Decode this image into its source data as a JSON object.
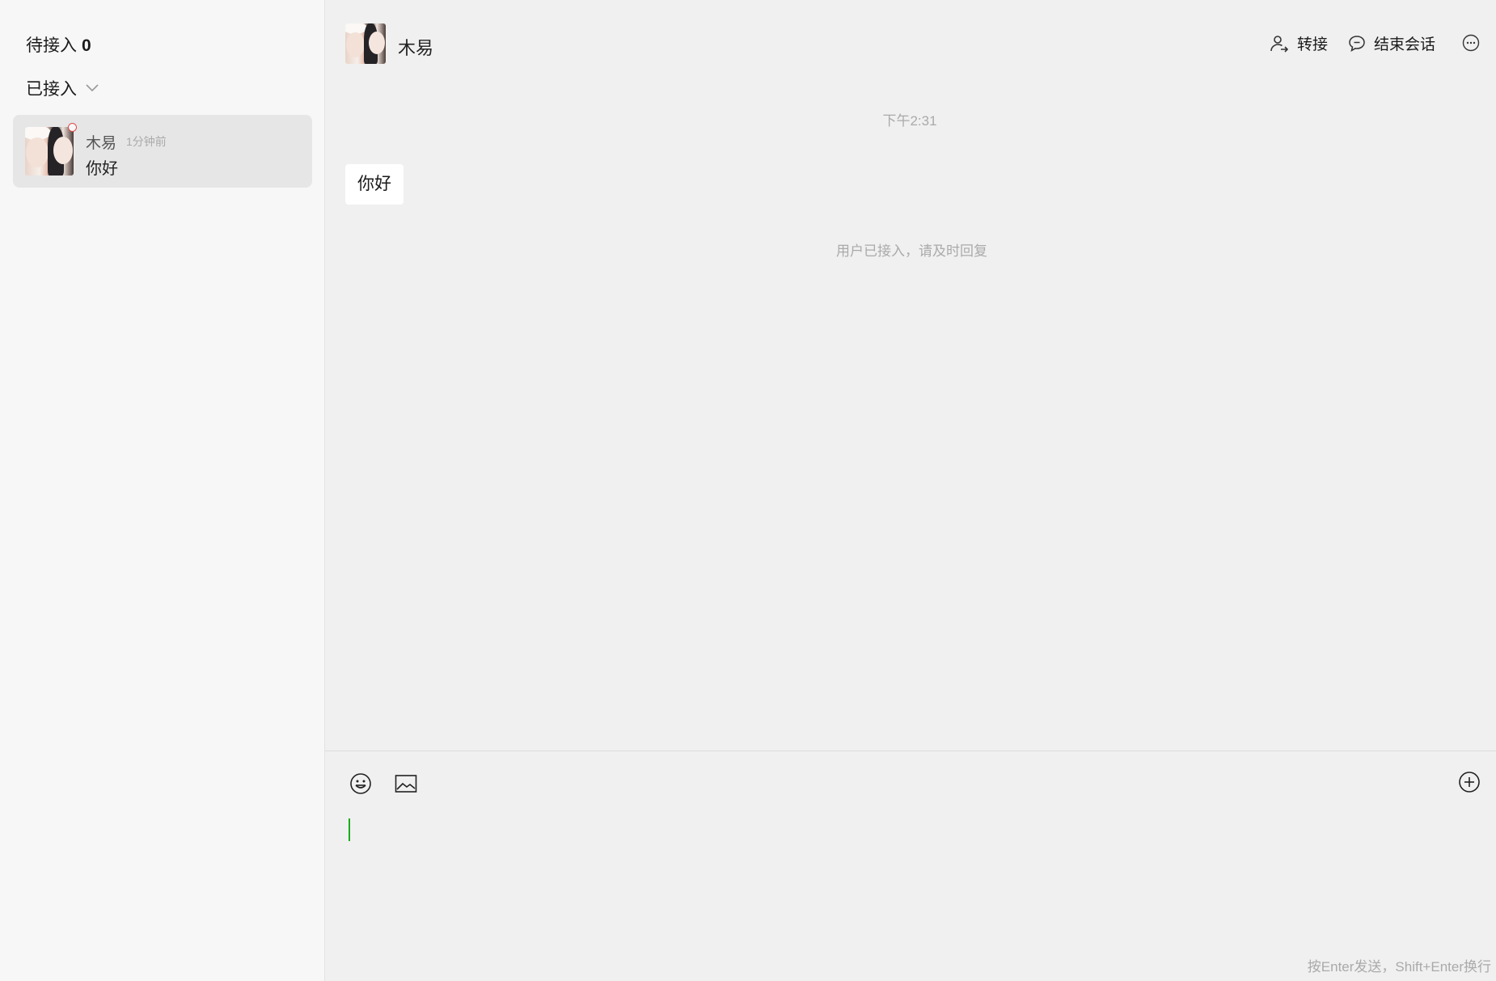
{
  "sidebar": {
    "pending_label": "待接入",
    "pending_count": "0",
    "joined_label": "已接入",
    "conversations": [
      {
        "name": "木易",
        "time": "1分钟前",
        "preview": "你好",
        "unread": true
      }
    ]
  },
  "chat": {
    "contact_name": "木易",
    "actions": {
      "transfer_label": "转接",
      "end_label": "结束会话",
      "more_icon": "more-icon"
    },
    "messages": [
      {
        "type": "timestamp",
        "text": "下午2:31"
      },
      {
        "type": "incoming",
        "text": "你好"
      },
      {
        "type": "system",
        "text": "用户已接入，请及时回复"
      }
    ]
  },
  "composer": {
    "tools": [
      "emoji-icon",
      "image-icon",
      "plus-circle-icon"
    ],
    "hint": "按Enter发送，Shift+Enter换行",
    "value": ""
  },
  "colors": {
    "accent_caret": "#1aad19",
    "unread_dot": "#e24b4b",
    "sidebar_bg": "#f7f7f7",
    "chat_bg": "#f0f0f0",
    "selected_item_bg": "#e6e6e6"
  }
}
